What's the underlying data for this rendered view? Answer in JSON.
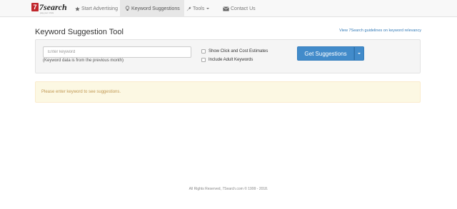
{
  "brand": {
    "name": "7search",
    "mark": "7",
    "tagline": "pay per click"
  },
  "nav": {
    "start_advertising": "Start Advertising",
    "keyword_suggestions": "Keyword Suggestions",
    "tools": "Tools",
    "contact_us": "Contact Us",
    "active": "keyword_suggestions"
  },
  "header": {
    "title": "Keyword Suggestion Tool",
    "guide_link": "View 7Search guidelines on keyword relevancy"
  },
  "form": {
    "keyword_placeholder": "Enter keyword",
    "keyword_value": "",
    "help_text": "(Keyword data is from the previous month)",
    "show_click_cost_label": "Show Click and Cost Estimates",
    "show_click_cost_checked": false,
    "include_adult_label": "Include Adult Keywords",
    "include_adult_checked": false,
    "submit_label": "Get Suggestions"
  },
  "alert": {
    "message": "Please enter keyword to see suggestions."
  },
  "footer": {
    "text": "All Rights Reserved, 7Search.com © 1999 - 2018."
  },
  "colors": {
    "primary": "#428bca",
    "alert_bg": "#fcf8e3",
    "alert_text": "#c09853",
    "brand_red": "#c0272d",
    "link": "#337ab7"
  }
}
